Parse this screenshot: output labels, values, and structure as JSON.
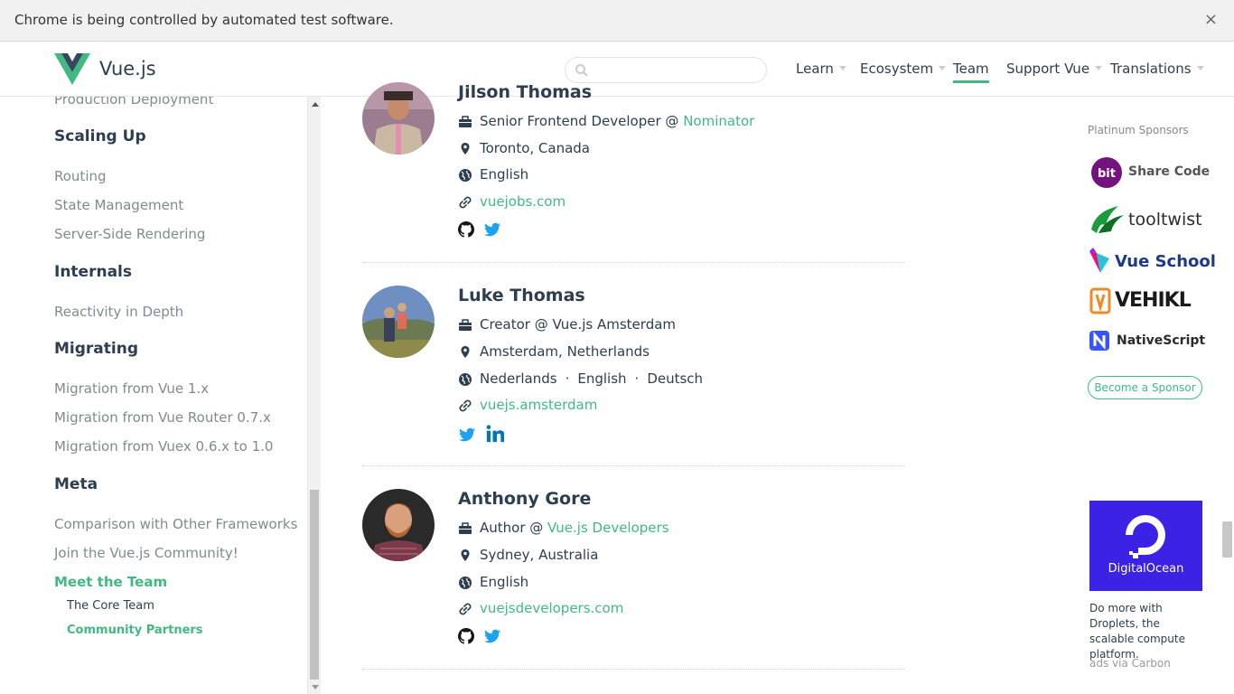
{
  "infobar": {
    "text": "Chrome is being controlled by automated test software.",
    "close": "×"
  },
  "header": {
    "logo_text": "Vue.js",
    "search_placeholder": "",
    "nav": [
      {
        "label": "Learn",
        "dropdown": true
      },
      {
        "label": "Ecosystem",
        "dropdown": true
      },
      {
        "label": "Team",
        "active": true
      },
      {
        "label": "Support Vue",
        "dropdown": true
      },
      {
        "label": "Translations",
        "dropdown": true
      }
    ]
  },
  "sidebar": {
    "items": [
      {
        "type": "link",
        "label": "Production Deployment"
      },
      {
        "type": "heading",
        "label": "Scaling Up"
      },
      {
        "type": "link",
        "label": "Routing"
      },
      {
        "type": "link",
        "label": "State Management"
      },
      {
        "type": "link",
        "label": "Server-Side Rendering"
      },
      {
        "type": "heading",
        "label": "Internals"
      },
      {
        "type": "link",
        "label": "Reactivity in Depth"
      },
      {
        "type": "heading",
        "label": "Migrating"
      },
      {
        "type": "link",
        "label": "Migration from Vue 1.x"
      },
      {
        "type": "link",
        "label": "Migration from Vue Router 0.7.x"
      },
      {
        "type": "link",
        "label": "Migration from Vuex 0.6.x to 1.0"
      },
      {
        "type": "heading",
        "label": "Meta"
      },
      {
        "type": "link",
        "label": "Comparison with Other Frameworks"
      },
      {
        "type": "link",
        "label": "Join the Vue.js Community!"
      },
      {
        "type": "link",
        "label": "Meet the Team",
        "active": true
      },
      {
        "type": "sub",
        "label": "The Core Team"
      },
      {
        "type": "sub",
        "label": "Community Partners",
        "active": true
      }
    ]
  },
  "members": [
    {
      "name": "Jilson Thomas",
      "work_title": "Senior Frontend Developer @ ",
      "work_org": "Nominator",
      "location": "Toronto, Canada",
      "languages": [
        "English"
      ],
      "website": "vuejobs.com",
      "socials": [
        "github",
        "twitter"
      ]
    },
    {
      "name": "Luke Thomas",
      "work_title": "Creator @ Vue.js Amsterdam",
      "work_org": "",
      "location": "Amsterdam, Netherlands",
      "languages": [
        "Nederlands",
        "English",
        "Deutsch"
      ],
      "website": "vuejs.amsterdam",
      "socials": [
        "twitter",
        "linkedin"
      ]
    },
    {
      "name": "Anthony Gore",
      "work_title": "Author @ ",
      "work_org": "Vue.js Developers",
      "location": "Sydney, Australia",
      "languages": [
        "English"
      ],
      "website": "vuejsdevelopers.com",
      "socials": [
        "github",
        "twitter"
      ]
    }
  ],
  "sponsors": {
    "title": "Platinum Sponsors",
    "items": [
      {
        "name": "bit",
        "label": "Share Code"
      },
      {
        "name": "tooltwist",
        "label": "tooltwist"
      },
      {
        "name": "vueschool",
        "label": "Vue School"
      },
      {
        "name": "vehikl",
        "label": "VEHIKL"
      },
      {
        "name": "nativescript",
        "label": "NativeScript"
      }
    ],
    "become": "Become a Sponsor"
  },
  "carbon": {
    "brand": "DigitalOcean",
    "text": "Do more with Droplets, the scalable compute platform.",
    "via": "ads via Carbon"
  },
  "colors": {
    "accent": "#42b983",
    "text": "#2c3e50",
    "muted": "#7f8c8d",
    "twitter": "#1da1f2",
    "linkedin": "#0077b5"
  }
}
